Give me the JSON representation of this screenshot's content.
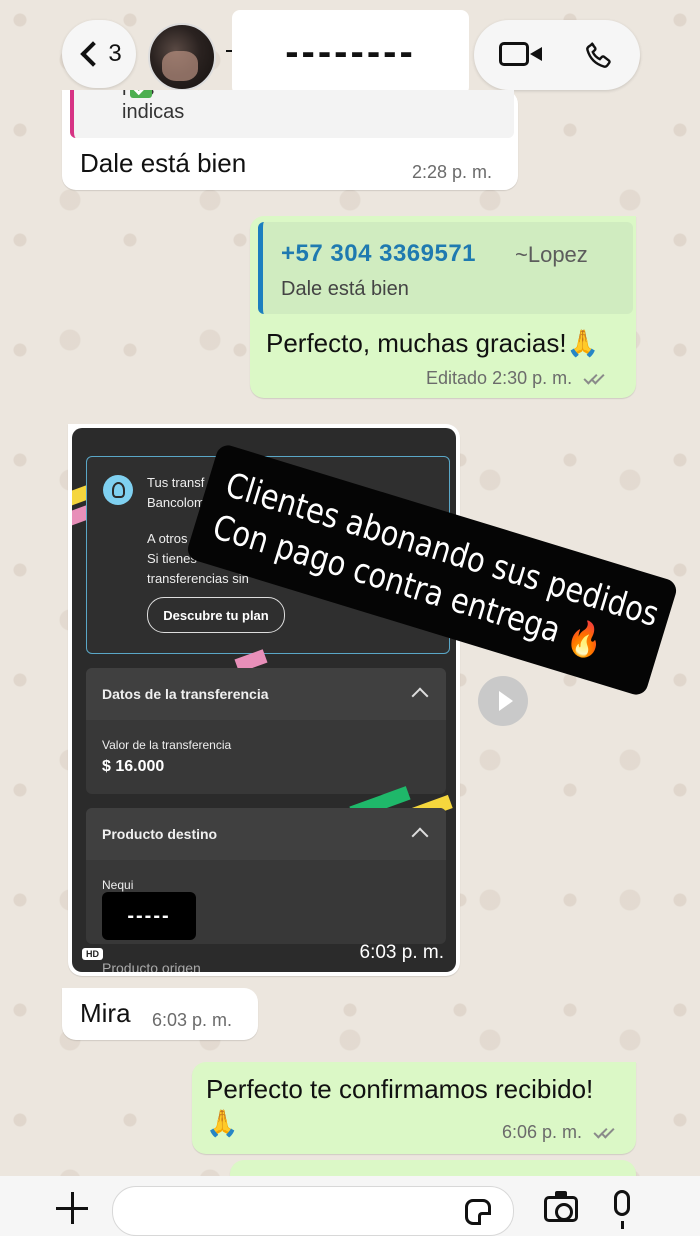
{
  "header": {
    "back_count": "3",
    "contact_name": "--------",
    "icons": [
      "chevron-left-icon",
      "video-call-icon",
      "phone-icon"
    ]
  },
  "messages": [
    {
      "direction": "incoming",
      "quote_text": "nos indicas",
      "text": "Dale está bien",
      "time": "2:28 p. m."
    },
    {
      "direction": "outgoing",
      "quote_phone": "+57 304 3369571",
      "quote_alias": "~Lopez",
      "quote_text": "Dale está bien",
      "text": "Perfecto, muchas gracias!🙏",
      "edited_label": "Editado",
      "time": "2:30 p. m."
    },
    {
      "direction": "incoming",
      "type": "image",
      "time": "6:03 p. m.",
      "hd_label": "HD",
      "image": {
        "tip_lines": [
          "Tus transf",
          "Bancolom",
          "A otros",
          "Si tienes",
          "transferencias sin"
        ],
        "discover_button": "Descubre tu plan",
        "section1_title": "Datos de la transferencia",
        "amount_label": "Valor de la transferencia",
        "amount_value": "$ 16.000",
        "section2_title": "Producto destino",
        "destination_label": "Nequi",
        "destination_redacted": "-----",
        "origin_label": "Producto origen"
      }
    },
    {
      "direction": "incoming",
      "text": "Mira",
      "time": "6:03 p. m."
    },
    {
      "direction": "outgoing",
      "text": "Perfecto te confirmamos recibido! 🙏",
      "time": "6:06 p. m."
    }
  ],
  "overlay": {
    "line1": "Clientes abonando sus pedidos",
    "line2": "Con pago contra entrega 🔥"
  },
  "composer": {
    "placeholder": "",
    "icons": [
      "plus-icon",
      "sticker-icon",
      "camera-icon",
      "microphone-icon"
    ]
  },
  "colors": {
    "outgoing_bubble": "#dbf8c6",
    "incoming_bubble": "#ffffff",
    "quote_bar": "#1c7fbf",
    "phone_link": "#1f7ab0"
  }
}
